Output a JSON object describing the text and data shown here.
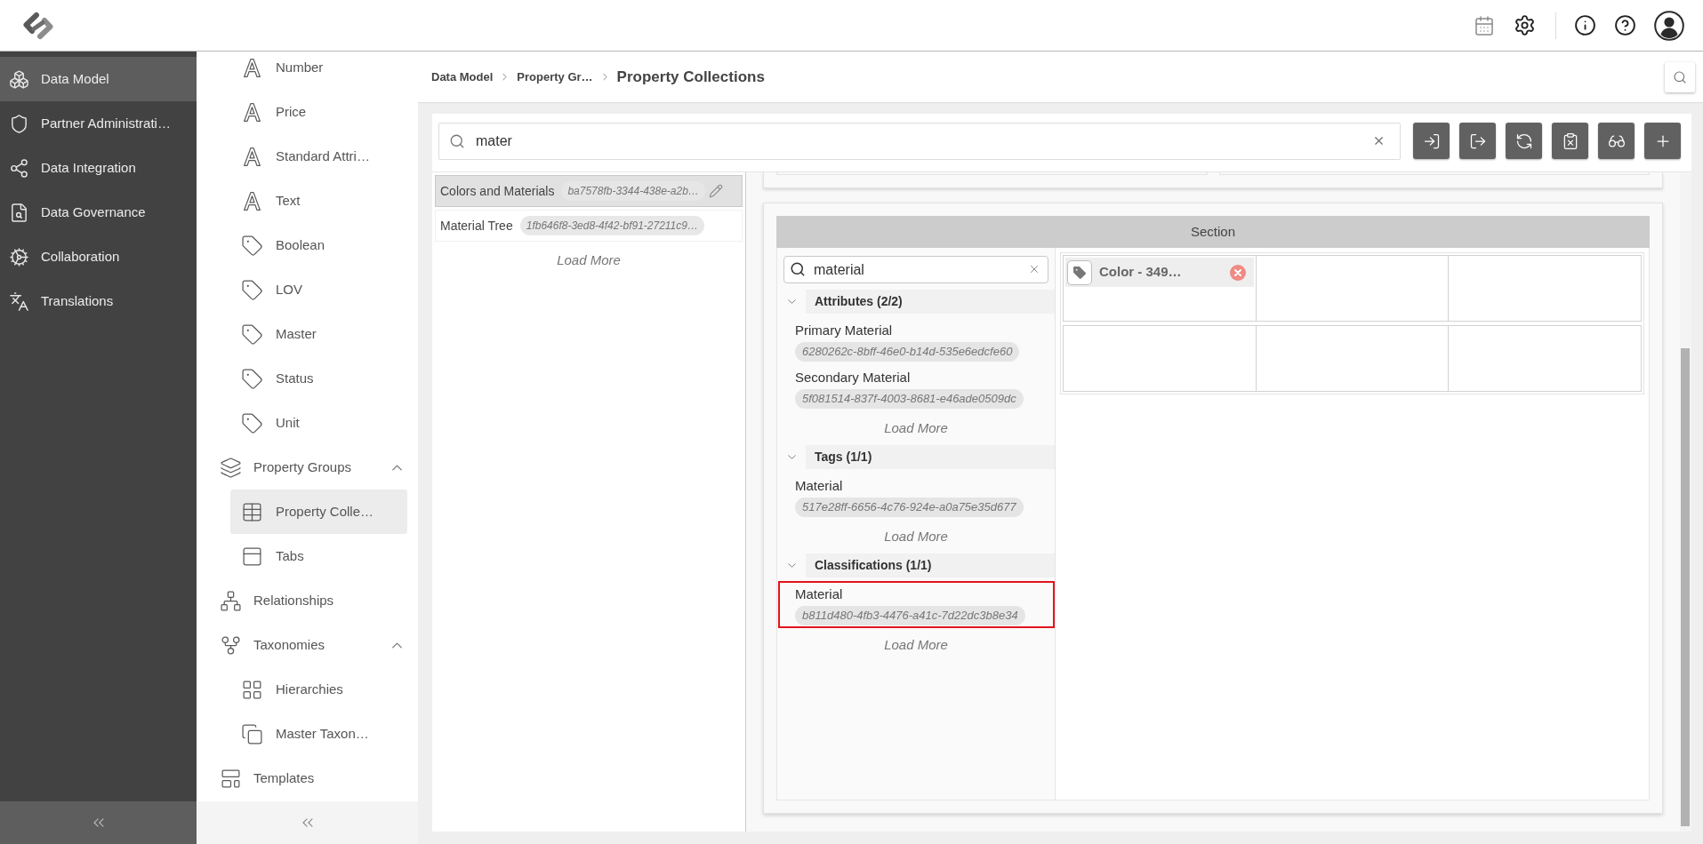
{
  "sidebar": {
    "items": [
      {
        "label": "Data Model",
        "kind": "model",
        "selected": true
      },
      {
        "label": "Partner Administrati…",
        "kind": "partner",
        "selected": false
      },
      {
        "label": "Data Integration",
        "kind": "integration",
        "selected": false
      },
      {
        "label": "Data Governance",
        "kind": "governance",
        "selected": false
      },
      {
        "label": "Collaboration",
        "kind": "collaboration",
        "selected": false
      },
      {
        "label": "Translations",
        "kind": "translations",
        "selected": false
      }
    ]
  },
  "subnav": {
    "items": [
      {
        "children": [
          {
            "label": "Number",
            "kind": "attribute",
            "selected": false
          },
          {
            "label": "Price",
            "kind": "attribute",
            "selected": false
          },
          {
            "label": "Standard Attri…",
            "kind": "attribute",
            "selected": false
          },
          {
            "label": "Text",
            "kind": "attribute",
            "selected": false
          },
          {
            "label": "Boolean",
            "kind": "tag",
            "selected": false
          },
          {
            "label": "LOV",
            "kind": "tag",
            "selected": false
          },
          {
            "label": "Master",
            "kind": "tag",
            "selected": false
          },
          {
            "label": "Status",
            "kind": "tag",
            "selected": false
          },
          {
            "label": "Unit",
            "kind": "tag",
            "selected": false
          }
        ]
      },
      {
        "label": "Property Groups",
        "kind": "group",
        "selected": false,
        "expanded": true,
        "children": [
          {
            "label": "Property Colle…",
            "kind": "collection",
            "selected": true
          },
          {
            "label": "Tabs",
            "kind": "tabs",
            "selected": false
          }
        ]
      },
      {
        "label": "Relationships",
        "kind": "relationships",
        "selected": false
      },
      {
        "label": "Taxonomies",
        "kind": "taxonomy",
        "selected": false,
        "expanded": true,
        "children": [
          {
            "label": "Hierarchies",
            "kind": "hierarchy",
            "selected": false
          },
          {
            "label": "Master Taxon…",
            "kind": "mastertaxonomy",
            "selected": false
          }
        ]
      },
      {
        "label": "Templates",
        "kind": "template",
        "selected": false
      }
    ]
  },
  "breadcrumb": {
    "items": [
      {
        "label": "Data Model",
        "current": false
      },
      {
        "label": "Property Gr…",
        "current": false
      },
      {
        "label": "Property Collections",
        "current": true
      }
    ]
  },
  "search": {
    "value": "mater"
  },
  "collections": {
    "items": [
      {
        "name": "Colors and Materials",
        "id": "ba7578fb-3344-438e-a2b…",
        "selected": true
      },
      {
        "name": "Material Tree",
        "id": "1fb646f8-3ed8-4f42-bf91-27211c9…",
        "selected": false
      }
    ],
    "load_more": "Load More"
  },
  "section": {
    "title": "Section",
    "search": {
      "value": "material"
    },
    "groups": [
      {
        "label": "Attributes (2/2)",
        "expanded": true,
        "items": [
          {
            "name": "Primary Material",
            "id": "6280262c-8bff-46e0-b14d-535e6edcfe60",
            "highlighted": false
          },
          {
            "name": "Secondary Material",
            "id": "5f081514-837f-4003-8681-e46ade0509dc",
            "highlighted": false
          }
        ],
        "load_more": "Load More"
      },
      {
        "label": "Tags (1/1)",
        "expanded": true,
        "items": [
          {
            "name": "Material",
            "id": "517e28ff-6656-4c76-924e-a0a75e35d677",
            "highlighted": false
          }
        ],
        "load_more": "Load More"
      },
      {
        "label": "Classifications (1/1)",
        "expanded": true,
        "items": [
          {
            "name": "Material",
            "id": "b811d480-4fb3-4476-a41c-7d22dc3b8e34",
            "highlighted": true
          }
        ],
        "load_more": "Load More"
      }
    ],
    "grid": {
      "rows": [
        {
          "cells": [
            {
              "items": [
                {
                  "label": "Color - 349…",
                  "kind": "tag"
                }
              ]
            },
            {},
            {}
          ]
        },
        {
          "cells": [
            {},
            {},
            {}
          ]
        }
      ]
    }
  }
}
